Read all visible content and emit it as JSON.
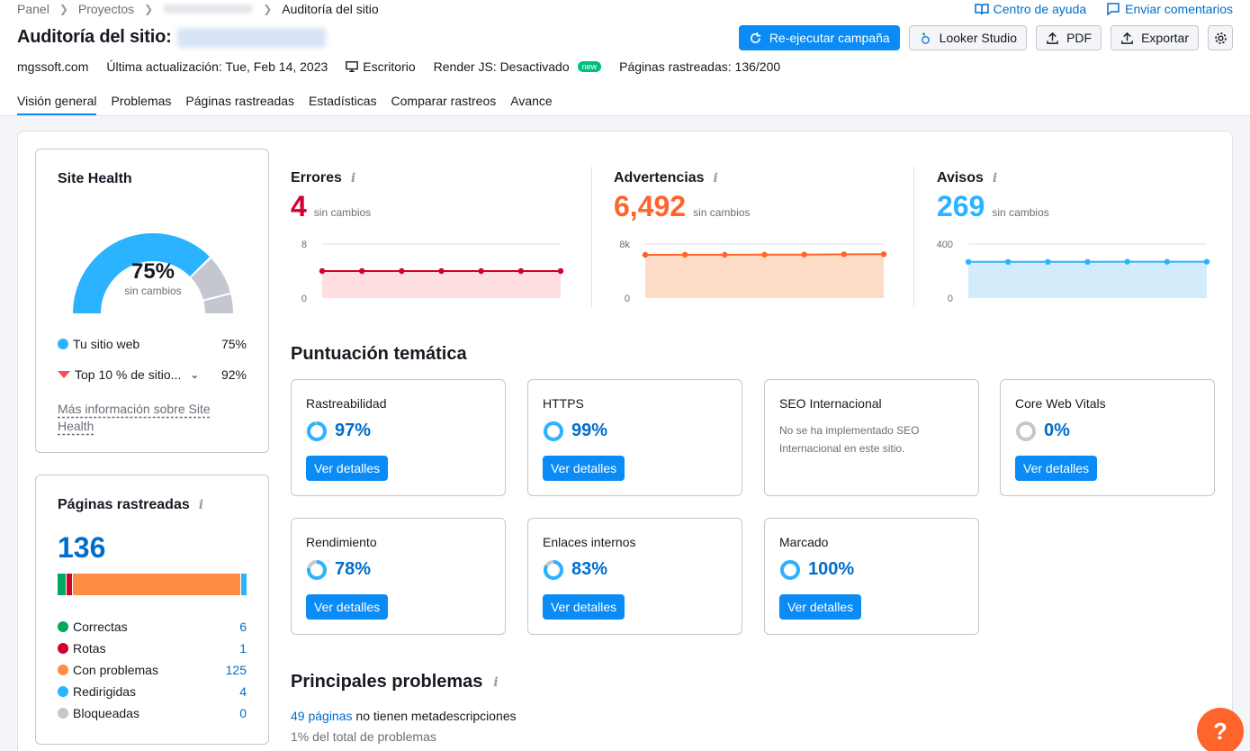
{
  "breadcrumbs": {
    "panel": "Panel",
    "projects": "Proyectos",
    "current": "Auditoría del sitio"
  },
  "toplinks": {
    "help": "Centro de ayuda",
    "feedback": "Enviar comentarios"
  },
  "title": "Auditoría del sitio:",
  "actions": {
    "rerun": "Re-ejecutar campaña",
    "looker": "Looker Studio",
    "pdf": "PDF",
    "export": "Exportar"
  },
  "meta": {
    "domain": "mgssoft.com",
    "updated": "Última actualización: Tue, Feb 14, 2023",
    "device": "Escritorio",
    "render": "Render JS: Desactivado",
    "render_badge": "new",
    "crawled": "Páginas rastreadas: 136/200"
  },
  "tabs": [
    "Visión general",
    "Problemas",
    "Páginas rastreadas",
    "Estadísticas",
    "Comparar rastreos",
    "Avance"
  ],
  "site_health": {
    "title": "Site Health",
    "value": "75%",
    "value_fraction": 0.75,
    "top10_fraction": 0.92,
    "note": "sin cambios",
    "legend": [
      {
        "label": "Tu sitio web",
        "value": "75%"
      },
      {
        "label": "Top 10 % de sitio...",
        "value": "92%"
      }
    ],
    "more": "Más información sobre Site Health"
  },
  "crawled_pages": {
    "title": "Páginas rastreadas",
    "total": "136",
    "rows": [
      {
        "label": "Correctas",
        "value": "6",
        "count": 6,
        "color": "#00a95f"
      },
      {
        "label": "Rotas",
        "value": "1",
        "count": 1,
        "color": "#d1002f"
      },
      {
        "label": "Con problemas",
        "value": "125",
        "count": 125,
        "color": "#ff8c43"
      },
      {
        "label": "Redirigidas",
        "value": "4",
        "count": 4,
        "color": "#2bb3ff"
      },
      {
        "label": "Bloqueadas",
        "value": "0",
        "count": 0,
        "color": "#c4c7cf"
      }
    ]
  },
  "metrics": [
    {
      "label": "Errores",
      "value": "4",
      "note": "sin cambios",
      "color": "#d1002f",
      "fill": "#ffdfe2",
      "y_top": "8",
      "y_bottom": "0",
      "ymax": 8,
      "series": [
        4,
        4,
        4,
        4,
        4,
        4,
        4
      ]
    },
    {
      "label": "Advertencias",
      "value": "6,492",
      "note": "sin cambios",
      "color": "#ff642d",
      "fill": "#ffdcc7",
      "y_top": "8k",
      "y_bottom": "0",
      "ymax": 8000,
      "series": [
        6400,
        6420,
        6420,
        6430,
        6440,
        6480,
        6492
      ]
    },
    {
      "label": "Avisos",
      "value": "269",
      "note": "sin cambios",
      "color": "#2bb3ff",
      "fill": "#d3ecfc",
      "y_top": "400",
      "y_bottom": "0",
      "ymax": 400,
      "series": [
        268,
        268,
        268,
        268,
        269,
        269,
        269
      ]
    }
  ],
  "thematic": {
    "title": "Puntuación temática",
    "button": "Ver detalles",
    "items": [
      {
        "name": "Rastreabilidad",
        "pct": "97%",
        "fraction": 0.97
      },
      {
        "name": "HTTPS",
        "pct": "99%",
        "fraction": 0.99
      },
      {
        "name": "SEO Internacional",
        "desc": "No se ha implementado SEO Internacional en este sitio."
      },
      {
        "name": "Core Web Vitals",
        "pct": "0%",
        "fraction": 0
      },
      {
        "name": "Rendimiento",
        "pct": "78%",
        "fraction": 0.78
      },
      {
        "name": "Enlaces internos",
        "pct": "83%",
        "fraction": 0.83
      },
      {
        "name": "Marcado",
        "pct": "100%",
        "fraction": 1
      }
    ]
  },
  "top_issues": {
    "title": "Principales problemas",
    "first_link": "49 páginas",
    "first_text": "no tienen metadescripciones",
    "first_sub": "1% del total de problemas"
  },
  "help_fab": "?"
}
